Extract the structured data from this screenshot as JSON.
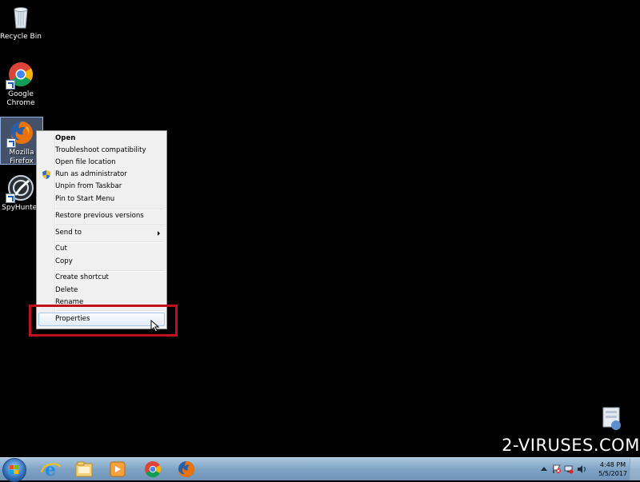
{
  "desktop": {
    "icons": [
      {
        "label": "Recycle Bin",
        "icon": "recycle-bin-icon"
      },
      {
        "label": "Google Chrome",
        "icon": "chrome-icon"
      },
      {
        "label": "Mozilla Firefox",
        "icon": "firefox-icon"
      },
      {
        "label": "SpyHunter",
        "icon": "spyhunter-icon"
      }
    ]
  },
  "context_menu": {
    "items": [
      {
        "label": "Open"
      },
      {
        "label": "Troubleshoot compatibility"
      },
      {
        "label": "Open file location"
      },
      {
        "label": "Run as administrator",
        "icon": "uac-shield-icon"
      },
      {
        "label": "Unpin from Taskbar"
      },
      {
        "label": "Pin to Start Menu"
      },
      {
        "label": "Restore previous versions"
      },
      {
        "label": "Send to",
        "icon": "submenu-arrow-icon"
      },
      {
        "label": "Cut"
      },
      {
        "label": "Copy"
      },
      {
        "label": "Create shortcut"
      },
      {
        "label": "Delete"
      },
      {
        "label": "Rename"
      },
      {
        "label": "Properties"
      }
    ],
    "highlight_color": "#c0101c"
  },
  "taskbar": {
    "pinned": [
      "start-orb-icon",
      "internet-explorer-icon",
      "file-explorer-icon",
      "media-player-icon",
      "chrome-icon",
      "firefox-icon"
    ],
    "tray": {
      "time": "4:48 PM",
      "date": "5/5/2017"
    }
  },
  "watermark": {
    "text": "2-VIRUSES.COM"
  }
}
